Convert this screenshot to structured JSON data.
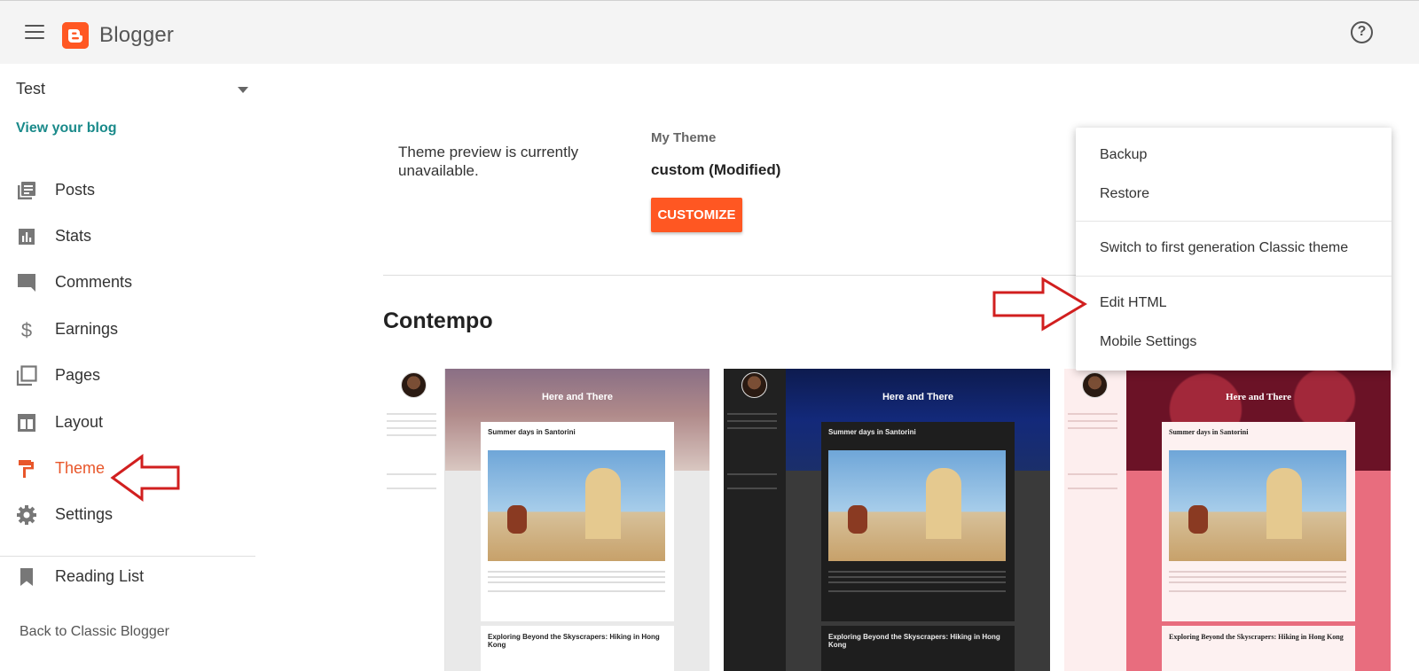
{
  "header": {
    "app_name": "Blogger",
    "menu_icon": "hamburger-menu-icon",
    "help_icon": "help-icon",
    "help_glyph": "?"
  },
  "sidebar": {
    "blog_name": "Test",
    "view_blog": "View your blog",
    "items": [
      {
        "label": "Posts",
        "icon": "posts-icon"
      },
      {
        "label": "Stats",
        "icon": "stats-icon"
      },
      {
        "label": "Comments",
        "icon": "comments-icon"
      },
      {
        "label": "Earnings",
        "icon": "dollar-icon"
      },
      {
        "label": "Pages",
        "icon": "pages-icon"
      },
      {
        "label": "Layout",
        "icon": "layout-icon"
      },
      {
        "label": "Theme",
        "icon": "theme-roller-icon",
        "active": true
      },
      {
        "label": "Settings",
        "icon": "gear-icon"
      },
      {
        "label": "Reading List",
        "icon": "bookmark-icon"
      }
    ],
    "back_classic": "Back to Classic Blogger"
  },
  "main": {
    "preview_message": "Theme preview is currently unavailable.",
    "my_theme_label": "My Theme",
    "theme_name": "custom (Modified)",
    "customize_label": "CUSTOMIZE",
    "section_title": "Contempo"
  },
  "menu": {
    "items": [
      "Backup",
      "Restore",
      "Switch to first generation Classic theme",
      "Edit HTML",
      "Mobile Settings"
    ]
  },
  "theme_cards": [
    {
      "hero_title": "Here and There",
      "post_title": "Summer days in Santorini",
      "post2_title": "Exploring Beyond the Skyscrapers: Hiking in Hong Kong"
    },
    {
      "hero_title": "Here and There",
      "post_title": "Summer days in Santorini",
      "post2_title": "Exploring Beyond the Skyscrapers: Hiking in Hong Kong"
    },
    {
      "hero_title": "Here and There",
      "post_title": "Summer days in Santorini",
      "post2_title": "Exploring Beyond the Skyscrapers: Hiking in Hong Kong"
    }
  ],
  "colors": {
    "accent": "#ff5722",
    "active_nav": "#e8562a",
    "link": "#1a8a8a",
    "annotation_arrow": "#d11f1f"
  }
}
